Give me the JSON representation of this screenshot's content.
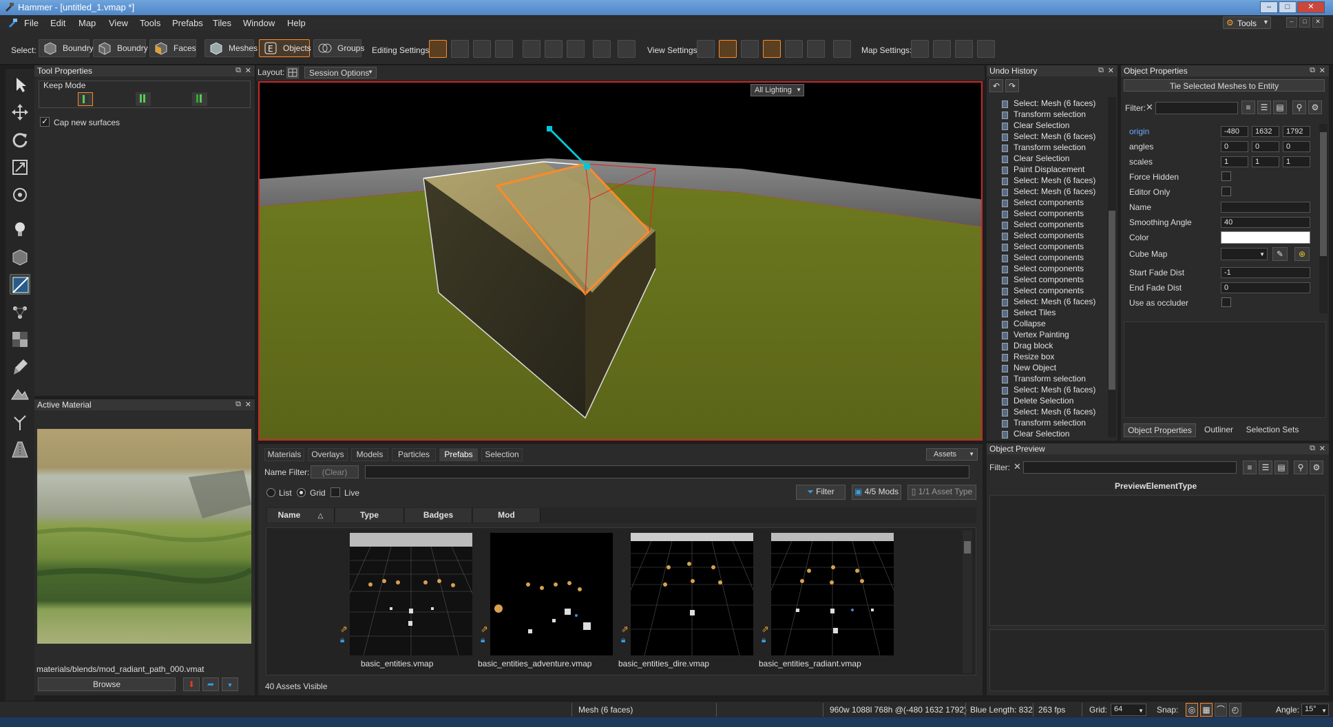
{
  "window": {
    "title": "Hammer - [untitled_1.vmap *]"
  },
  "menu": [
    "File",
    "Edit",
    "Map",
    "View",
    "Tools",
    "Prefabs",
    "Tiles",
    "Window",
    "Help"
  ],
  "menu_right": {
    "tools_label": "Tools"
  },
  "toolbar": {
    "select_label": "Select:",
    "select_modes": [
      "Boundry",
      "Boundry",
      "Faces",
      "Meshes",
      "Objects",
      "Groups"
    ],
    "active_mode": "Objects",
    "editing_label": "Editing Settings:",
    "view_label": "View Settings:",
    "map_label": "Map Settings:"
  },
  "tool_properties": {
    "title": "Tool Properties",
    "keep_mode_label": "Keep Mode",
    "cap_label": "Cap new surfaces",
    "cap_checked": true
  },
  "active_material": {
    "title": "Active Material",
    "path": "materials/blends/mod_radiant_path_000.vmat",
    "browse_label": "Browse"
  },
  "viewport": {
    "layout_label": "Layout:",
    "session_options": "Session Options",
    "lighting": "All Lighting"
  },
  "undo_history": {
    "title": "Undo History",
    "items": [
      "Select: Mesh (6 faces)",
      "Transform selection",
      "Clear Selection",
      "Select: Mesh (6 faces)",
      "Transform selection",
      "Clear Selection",
      "Paint Displacement",
      "Select: Mesh (6 faces)",
      "Select: Mesh (6 faces)",
      "Select components",
      "Select components",
      "Select components",
      "Select components",
      "Select components",
      "Select components",
      "Select components",
      "Select components",
      "Select components",
      "Select: Mesh (6 faces)",
      "Select Tiles",
      "Collapse",
      "Vertex Painting",
      "Drag block",
      "Resize box",
      "New Object",
      "Transform selection",
      "Select: Mesh (6 faces)",
      "Delete Selection",
      "Select: Mesh (6 faces)",
      "Transform selection",
      "Clear Selection"
    ]
  },
  "object_properties": {
    "title": "Object Properties",
    "tie_button": "Tie Selected Meshes to Entity",
    "filter_label": "Filter:",
    "origin_label": "origin",
    "origin": [
      "-480",
      "1632",
      "1792"
    ],
    "angles_label": "angles",
    "angles": [
      "0",
      "0",
      "0"
    ],
    "scales_label": "scales",
    "scales": [
      "1",
      "1",
      "1"
    ],
    "force_hidden": "Force Hidden",
    "editor_only": "Editor Only",
    "name_label": "Name",
    "smoothing_label": "Smoothing Angle",
    "smoothing_value": "40",
    "color_label": "Color",
    "cubemap_label": "Cube Map",
    "start_fade_label": "Start Fade Dist",
    "start_fade_value": "-1",
    "end_fade_label": "End Fade Dist",
    "end_fade_value": "0",
    "occluder_label": "Use as occluder",
    "tabs": [
      "Object Properties",
      "Outliner",
      "Selection Sets"
    ]
  },
  "object_preview": {
    "title": "Object Preview",
    "filter_label": "Filter:",
    "element_type": "PreviewElementType"
  },
  "assets": {
    "tabs": [
      "Materials",
      "Overlays",
      "Models",
      "Particles",
      "Prefabs",
      "Selection"
    ],
    "active_tab": "Prefabs",
    "assets_dropdown": "Assets",
    "name_filter_label": "Name Filter:",
    "clear_label": "(Clear)",
    "view_list": "List",
    "view_grid": "Grid",
    "live_label": "Live",
    "filter_button": "Filter",
    "mods_button": "4/5 Mods",
    "asset_type_button": "1/1 Asset Type",
    "columns": [
      "Name",
      "Type",
      "Badges",
      "Mod"
    ],
    "items": [
      "basic_entities.vmap",
      "basic_entities_adventure.vmap",
      "basic_entities_dire.vmap",
      "basic_entities_radiant.vmap"
    ],
    "visible_count": "40 Assets Visible"
  },
  "status": {
    "selection": "Mesh (6 faces)",
    "dims": "960w 1088l 768h @(-480 1632 1792)",
    "blue_length": "Blue Length: 832",
    "fps": "263 fps",
    "grid_label": "Grid:",
    "grid_value": "64",
    "snap_label": "Snap:",
    "angle_label": "Angle:",
    "angle_value": "15°"
  },
  "colors": {
    "accent": "#ff8a2a",
    "viewport_border": "#c9282a",
    "selection_edge": "#00c8d8"
  }
}
